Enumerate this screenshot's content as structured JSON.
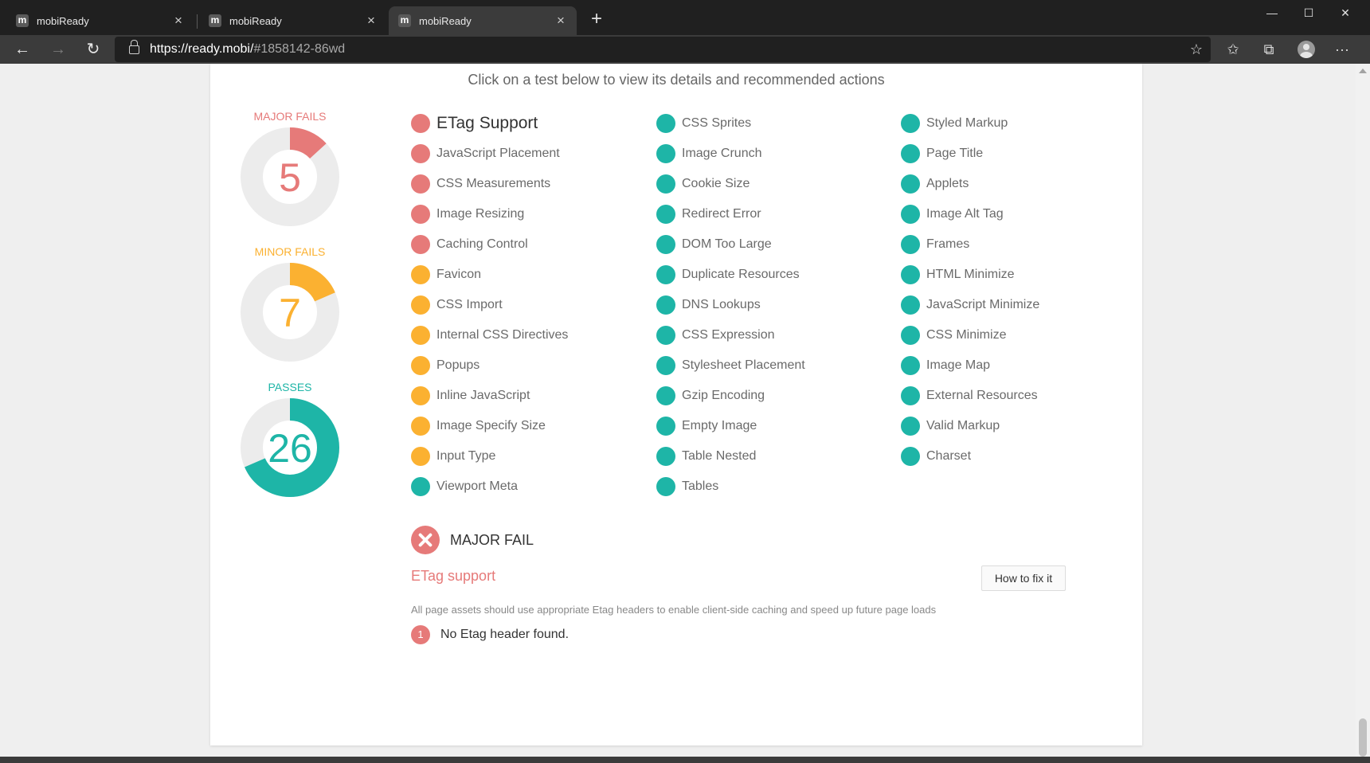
{
  "browser": {
    "tabs": [
      {
        "favicon": "m",
        "title": "mobiReady",
        "close": "×"
      },
      {
        "favicon": "m",
        "title": "mobiReady",
        "close": "×"
      },
      {
        "favicon": "m",
        "title": "mobiReady",
        "close": "×"
      }
    ],
    "new_tab": "+",
    "url_host": "https://ready.mobi/",
    "url_rest": "#1858142-86wd",
    "window_buttons": {
      "minimize": "—",
      "maximize": "☐",
      "close": "✕"
    },
    "nav": {
      "back": "←",
      "forward": "→",
      "reload": "↻"
    },
    "toolbar_icons": {
      "add_favorite": "☆",
      "favorites": "✩",
      "collections": "⧉",
      "more": "···"
    }
  },
  "page": {
    "instruction": "Click on a test below to view its details and recommended actions",
    "colors": {
      "major": "#e67a79",
      "minor": "#fbb131",
      "pass": "#1eb5a7",
      "track": "#ececec"
    },
    "stats": [
      {
        "label": "MAJOR FAILS",
        "value": "5",
        "fraction": 0.1316,
        "kind": "major"
      },
      {
        "label": "MINOR FAILS",
        "value": "7",
        "fraction": 0.1842,
        "kind": "minor"
      },
      {
        "label": "PASSES",
        "value": "26",
        "fraction": 0.6842,
        "kind": "pass"
      }
    ],
    "tests": [
      [
        {
          "name": "ETag Support",
          "status": "major"
        },
        {
          "name": "JavaScript Placement",
          "status": "major"
        },
        {
          "name": "CSS Measurements",
          "status": "major"
        },
        {
          "name": "Image Resizing",
          "status": "major"
        },
        {
          "name": "Caching Control",
          "status": "major"
        },
        {
          "name": "Favicon",
          "status": "minor"
        },
        {
          "name": "CSS Import",
          "status": "minor"
        },
        {
          "name": "Internal CSS Directives",
          "status": "minor"
        },
        {
          "name": "Popups",
          "status": "minor"
        },
        {
          "name": "Inline JavaScript",
          "status": "minor"
        },
        {
          "name": "Image Specify Size",
          "status": "minor"
        },
        {
          "name": "Input Type",
          "status": "minor"
        },
        {
          "name": "Viewport Meta",
          "status": "pass"
        }
      ],
      [
        {
          "name": "CSS Sprites",
          "status": "pass"
        },
        {
          "name": "Image Crunch",
          "status": "pass"
        },
        {
          "name": "Cookie Size",
          "status": "pass"
        },
        {
          "name": "Redirect Error",
          "status": "pass"
        },
        {
          "name": "DOM Too Large",
          "status": "pass"
        },
        {
          "name": "Duplicate Resources",
          "status": "pass"
        },
        {
          "name": "DNS Lookups",
          "status": "pass"
        },
        {
          "name": "CSS Expression",
          "status": "pass"
        },
        {
          "name": "Stylesheet Placement",
          "status": "pass"
        },
        {
          "name": "Gzip Encoding",
          "status": "pass"
        },
        {
          "name": "Empty Image",
          "status": "pass"
        },
        {
          "name": "Table Nested",
          "status": "pass"
        },
        {
          "name": "Tables",
          "status": "pass"
        }
      ],
      [
        {
          "name": "Styled Markup",
          "status": "pass"
        },
        {
          "name": "Page Title",
          "status": "pass"
        },
        {
          "name": "Applets",
          "status": "pass"
        },
        {
          "name": "Image Alt Tag",
          "status": "pass"
        },
        {
          "name": "Frames",
          "status": "pass"
        },
        {
          "name": "HTML Minimize",
          "status": "pass"
        },
        {
          "name": "JavaScript Minimize",
          "status": "pass"
        },
        {
          "name": "CSS Minimize",
          "status": "pass"
        },
        {
          "name": "Image Map",
          "status": "pass"
        },
        {
          "name": "External Resources",
          "status": "pass"
        },
        {
          "name": "Valid Markup",
          "status": "pass"
        },
        {
          "name": "Charset",
          "status": "pass"
        }
      ]
    ],
    "selected_test": "ETag Support",
    "detail": {
      "status": "MAJOR FAIL",
      "title": "ETag support",
      "fix_button": "How to fix it",
      "description": "All page assets should use appropriate Etag headers to enable client-side caching and speed up future page loads",
      "findings": [
        {
          "num": "1",
          "text": "No Etag header found."
        }
      ]
    }
  }
}
